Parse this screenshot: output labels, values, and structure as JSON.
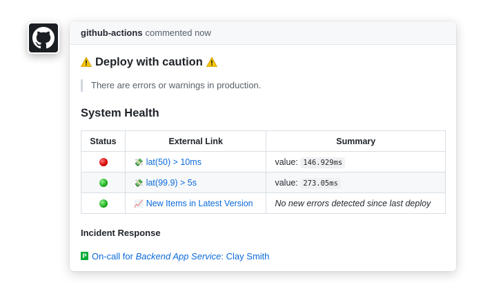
{
  "comment": {
    "author": "github-actions",
    "action": "commented now"
  },
  "deploy": {
    "title": "Deploy with caution",
    "quote": "There are errors or warnings in production."
  },
  "health": {
    "heading": "System Health",
    "columns": [
      "Status",
      "External Link",
      "Summary"
    ],
    "rows": [
      {
        "status": "red",
        "link_emoji": "💸",
        "link_text": "lat(50) > 10ms",
        "summary_prefix": "value:",
        "summary_code": "146.929ms"
      },
      {
        "status": "green",
        "link_emoji": "💸",
        "link_text": "lat(99.9) > 5s",
        "summary_prefix": "value:",
        "summary_code": "273.05ms"
      },
      {
        "status": "green",
        "link_emoji": "📈",
        "link_text": "New Items in Latest Version",
        "summary_text": "No new errors detected since last deploy"
      }
    ]
  },
  "incident": {
    "heading": "Incident Response",
    "oncall_prefix": "On-call for",
    "service": "Backend App Service",
    "separator": ":",
    "person": "Clay Smith",
    "pd_letter": "P"
  },
  "colors": {
    "link": "#0969da",
    "status_red": "#d40000",
    "status_green": "#1fae1f",
    "pagerduty": "#06ac38"
  }
}
